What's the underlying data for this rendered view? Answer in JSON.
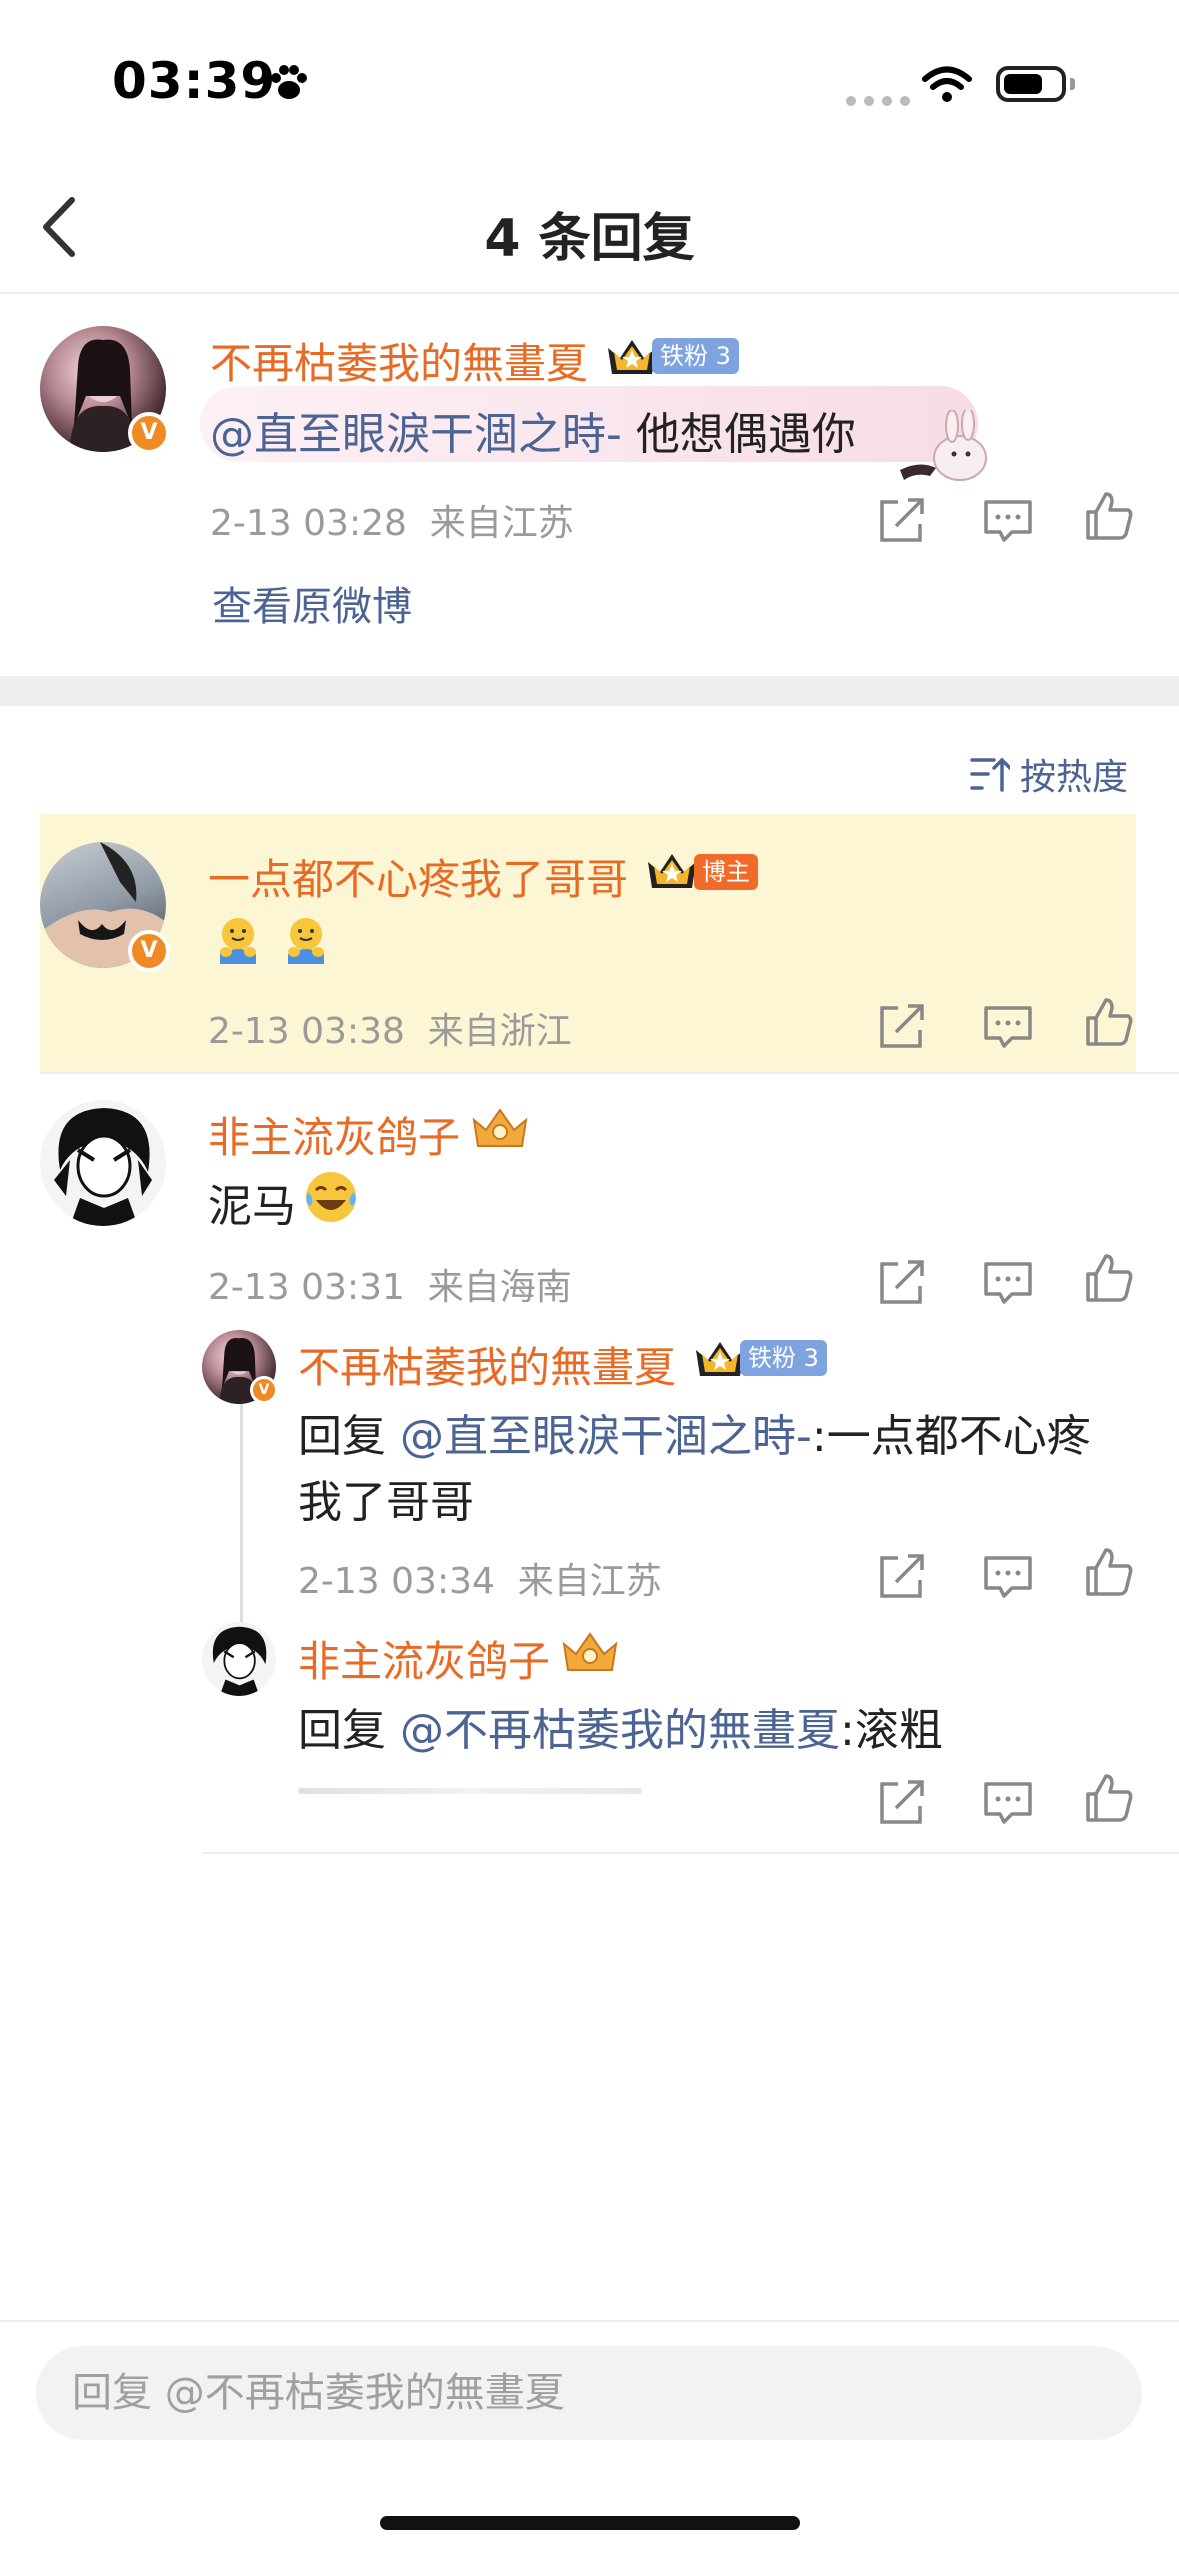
{
  "status_bar": {
    "time": "03:39"
  },
  "header": {
    "title": "4 条回复"
  },
  "original_comment": {
    "username": "不再枯萎我的無畫夏",
    "fan_badge": "铁粉 3",
    "mention": "@直至眼淚干涸之時-",
    "text": " 他想偶遇你",
    "time": "2-13 03:28",
    "location": "来自江苏",
    "view_original": "查看原微博"
  },
  "sort": {
    "label": "按热度"
  },
  "replies": [
    {
      "username": "一点都不心疼我了哥哥",
      "badge": "博主",
      "time": "2-13 03:38",
      "location": "来自浙江"
    },
    {
      "username": "非主流灰鸽子",
      "text": "泥马",
      "time": "2-13 03:31",
      "location": "来自海南"
    }
  ],
  "sub_replies": [
    {
      "username": "不再枯萎我的無畫夏",
      "fan_badge": "铁粉 3",
      "prefix": "回复 ",
      "mention": "@直至眼淚干涸之時-",
      "text_line1": ":一点都不心疼",
      "text_line2": "我了哥哥",
      "time": "2-13 03:34",
      "location": "来自江苏"
    },
    {
      "username": "非主流灰鸽子",
      "prefix": "回复 ",
      "mention": "@不再枯萎我的無畫夏",
      "text": ":滚粗"
    }
  ],
  "reply_box": {
    "placeholder": "回复 @不再枯萎我的無畫夏"
  },
  "colors": {
    "username": "#e86b25",
    "link": "#4c6494",
    "highlight_bg": "#fdf6d4",
    "meta": "#9a9a9a"
  }
}
